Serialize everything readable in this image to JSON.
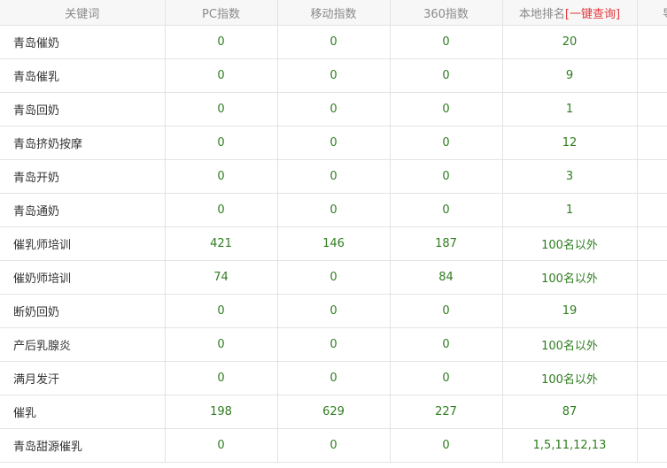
{
  "table": {
    "headers": {
      "keyword": "关键词",
      "pc_index": "PC指数",
      "mobile_index": "移动指数",
      "index_360": "360指数",
      "local_rank": "本地排名",
      "quick_query": "[一键查询]",
      "extra": "导"
    },
    "rows": [
      {
        "keyword": "青岛催奶",
        "pc": "0",
        "mobile": "0",
        "i360": "0",
        "rank": "20"
      },
      {
        "keyword": "青岛催乳",
        "pc": "0",
        "mobile": "0",
        "i360": "0",
        "rank": "9"
      },
      {
        "keyword": "青岛回奶",
        "pc": "0",
        "mobile": "0",
        "i360": "0",
        "rank": "1"
      },
      {
        "keyword": "青岛挤奶按摩",
        "pc": "0",
        "mobile": "0",
        "i360": "0",
        "rank": "12"
      },
      {
        "keyword": "青岛开奶",
        "pc": "0",
        "mobile": "0",
        "i360": "0",
        "rank": "3"
      },
      {
        "keyword": "青岛通奶",
        "pc": "0",
        "mobile": "0",
        "i360": "0",
        "rank": "1"
      },
      {
        "keyword": "催乳师培训",
        "pc": "421",
        "mobile": "146",
        "i360": "187",
        "rank": "100名以外"
      },
      {
        "keyword": "催奶师培训",
        "pc": "74",
        "mobile": "0",
        "i360": "84",
        "rank": "100名以外"
      },
      {
        "keyword": "断奶回奶",
        "pc": "0",
        "mobile": "0",
        "i360": "0",
        "rank": "19"
      },
      {
        "keyword": "产后乳腺炎",
        "pc": "0",
        "mobile": "0",
        "i360": "0",
        "rank": "100名以外"
      },
      {
        "keyword": "满月发汗",
        "pc": "0",
        "mobile": "0",
        "i360": "0",
        "rank": "100名以外"
      },
      {
        "keyword": "催乳",
        "pc": "198",
        "mobile": "629",
        "i360": "227",
        "rank": "87"
      },
      {
        "keyword": "青岛甜源催乳",
        "pc": "0",
        "mobile": "0",
        "i360": "0",
        "rank": "1,5,11,12,13"
      }
    ]
  },
  "colors": {
    "header_bg": "#f7f7f7",
    "header_text": "#8a8a8a",
    "value_text": "#2e7d1f",
    "link_text": "#e4393c",
    "border": "#e3e3e3"
  }
}
